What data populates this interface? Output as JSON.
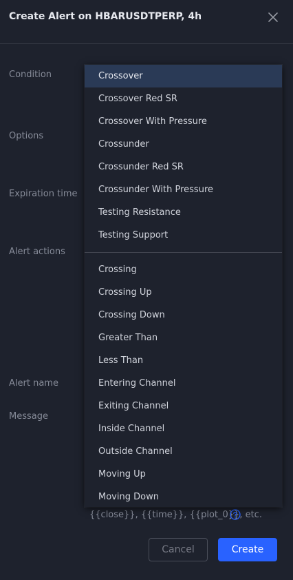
{
  "dialog": {
    "title": "Create Alert on HBARUSDTPERP, 4h"
  },
  "labels": {
    "condition": "Condition",
    "options": "Options",
    "expiration_time": "Expiration time",
    "alert_actions": "Alert actions",
    "alert_name": "Alert name",
    "message": "Message"
  },
  "dropdown": {
    "selected": "Crossover",
    "group1": [
      "Crossover",
      "Crossover Red SR",
      "Crossover With Pressure",
      "Crossunder",
      "Crossunder Red SR",
      "Crossunder With Pressure",
      "Testing Resistance",
      "Testing Support"
    ],
    "group2": [
      "Crossing",
      "Crossing Up",
      "Crossing Down",
      "Greater Than",
      "Less Than",
      "Entering Channel",
      "Exiting Channel",
      "Inside Channel",
      "Outside Channel",
      "Moving Up",
      "Moving Down"
    ]
  },
  "message_hint": "{{close}}, {{time}}, {{plot_0}}, etc.",
  "buttons": {
    "cancel": "Cancel",
    "create": "Create"
  },
  "icons": {
    "close": "close-icon",
    "help": "help-icon"
  },
  "colors": {
    "background": "#1e222d",
    "accent": "#2962ff",
    "selected_row": "#2a3a56"
  }
}
